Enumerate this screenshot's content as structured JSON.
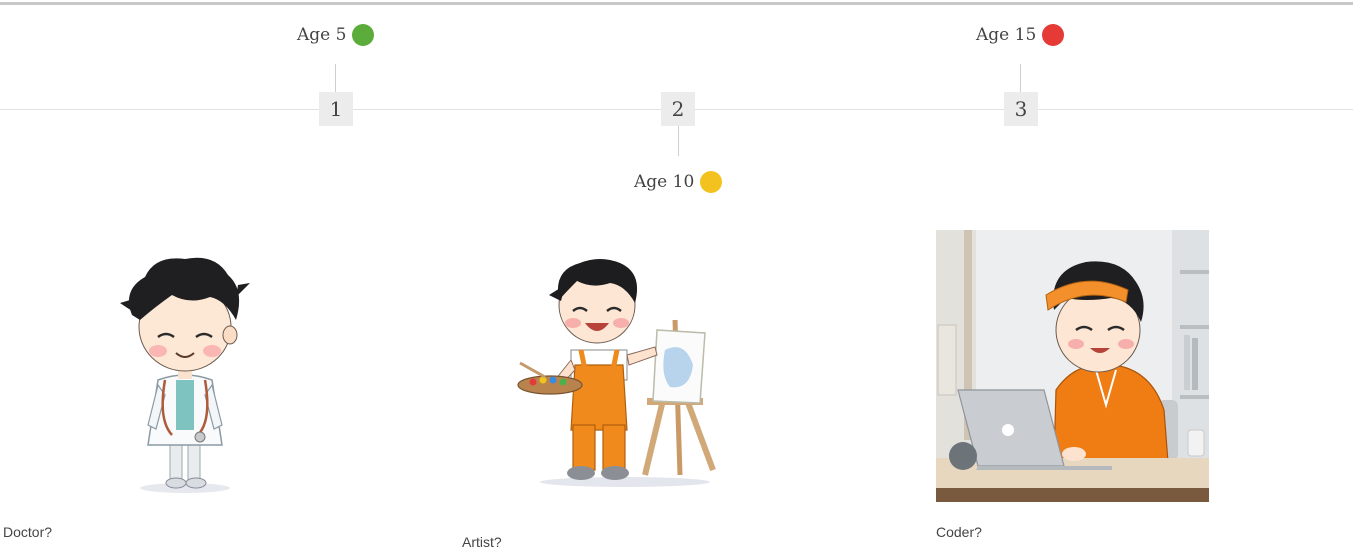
{
  "timeline": {
    "milestones": [
      {
        "step": "1",
        "age_label": "Age 5",
        "status_color": "#5cac3c",
        "caption": "Doctor?"
      },
      {
        "step": "2",
        "age_label": "Age 10",
        "status_color": "#f4c21f",
        "caption": "Artist?"
      },
      {
        "step": "3",
        "age_label": "Age 15",
        "status_color": "#e53a35",
        "caption": "Coder?"
      }
    ]
  },
  "illustrations": {
    "doctor": "cartoon boy in a white doctor's coat with a stethoscope",
    "artist": "cartoon boy in orange overalls holding a paint palette next to an easel",
    "coder": "cartoon boy in an orange hoodie and cap using a laptop at a desk"
  },
  "colors": {
    "accent_orange": "#f08a1c",
    "step_box": "#ececec",
    "axis_line": "#e2e2e2"
  }
}
